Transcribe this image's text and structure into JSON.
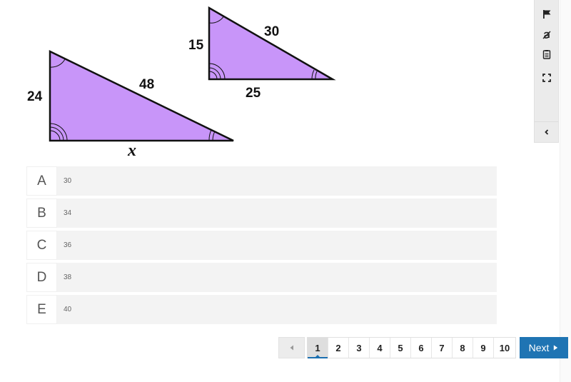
{
  "question_figure": {
    "large_triangle": {
      "side_vertical": "24",
      "hypotenuse": "48",
      "base": "x"
    },
    "small_triangle": {
      "side_vertical": "15",
      "hypotenuse": "30",
      "base": "25"
    },
    "fill_color": "#c895f9"
  },
  "choices": [
    {
      "letter": "A",
      "value": "30"
    },
    {
      "letter": "B",
      "value": "34"
    },
    {
      "letter": "C",
      "value": "36"
    },
    {
      "letter": "D",
      "value": "38"
    },
    {
      "letter": "E",
      "value": "40"
    }
  ],
  "toolbar": {
    "icons": [
      "flag-icon",
      "strikethrough-answer-icon",
      "notepad-icon",
      "fullscreen-icon"
    ],
    "collapse_icon": "chevron-left-icon"
  },
  "pagination": {
    "pages": [
      "1",
      "2",
      "3",
      "4",
      "5",
      "6",
      "7",
      "8",
      "9",
      "10"
    ],
    "current_page": "1",
    "next_label": "Next"
  },
  "colors": {
    "accent": "#1f74b3"
  }
}
